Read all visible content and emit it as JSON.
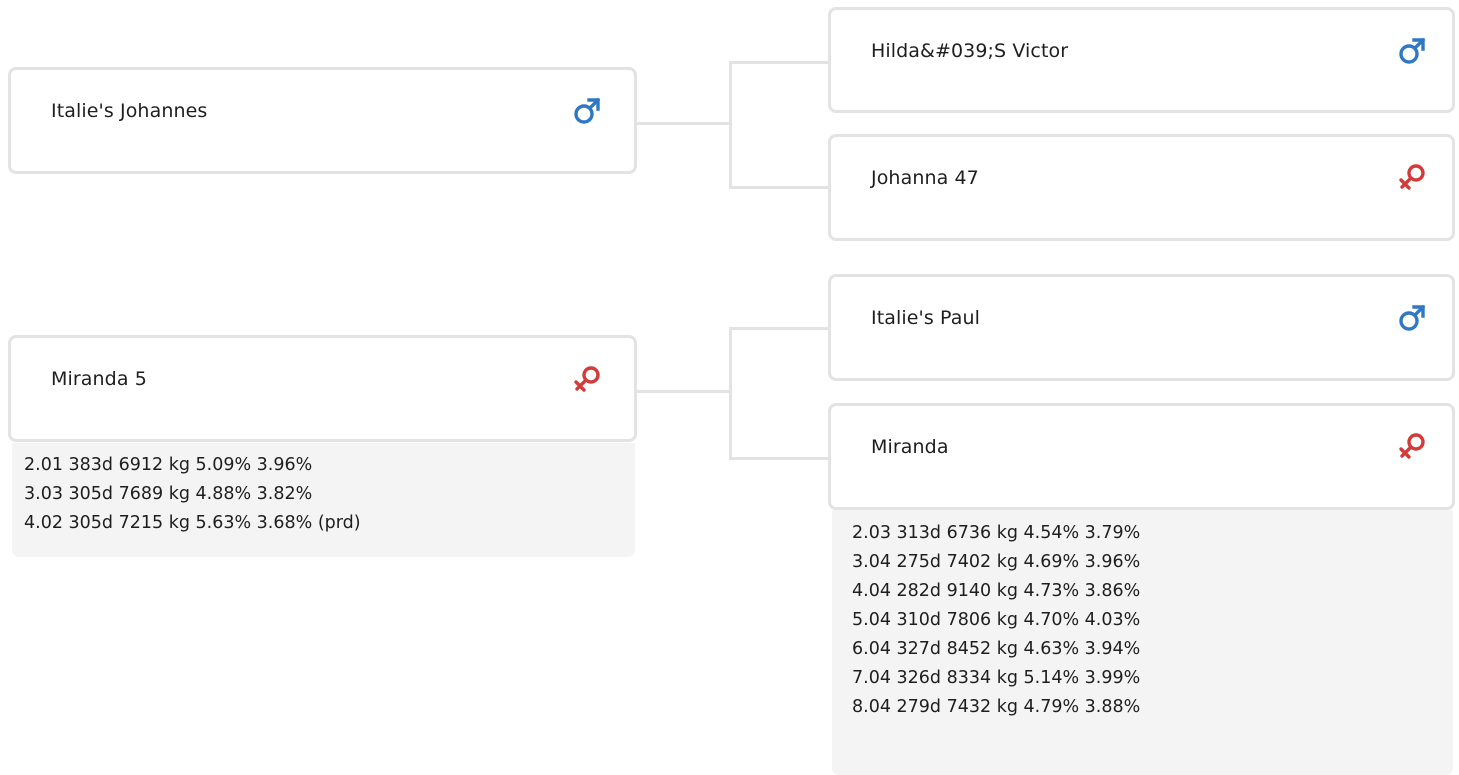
{
  "colors": {
    "male": "#2f78c4",
    "female": "#d33b3b",
    "border": "#e3e3e3",
    "records_bg": "#f4f4f4"
  },
  "animals": {
    "sire": {
      "name": "Italie's Johannes",
      "sex_icon": "male-icon"
    },
    "dam": {
      "name": "Miranda 5",
      "sex_icon": "female-icon",
      "records": [
        "2.01 383d 6912 kg 5.09% 3.96%",
        "3.03 305d 7689 kg 4.88% 3.82%",
        "4.02 305d 7215 kg 5.63% 3.68% (prd)"
      ]
    },
    "sire_sire": {
      "name": "Hilda&#039;S Victor",
      "sex_icon": "male-icon"
    },
    "sire_dam": {
      "name": "Johanna 47",
      "sex_icon": "female-icon"
    },
    "dam_sire": {
      "name": "Italie's Paul",
      "sex_icon": "male-icon"
    },
    "dam_dam": {
      "name": "Miranda",
      "sex_icon": "female-icon",
      "records": [
        "2.03 313d 6736 kg 4.54% 3.79%",
        "3.04 275d 7402 kg 4.69% 3.96%",
        "4.04 282d 9140 kg 4.73% 3.86%",
        "5.04 310d 7806 kg 4.70% 4.03%",
        "6.04 327d 8452 kg 4.63% 3.94%",
        "7.04 326d 8334 kg 5.14% 3.99%",
        "8.04 279d 7432 kg 4.79% 3.88%"
      ]
    }
  }
}
